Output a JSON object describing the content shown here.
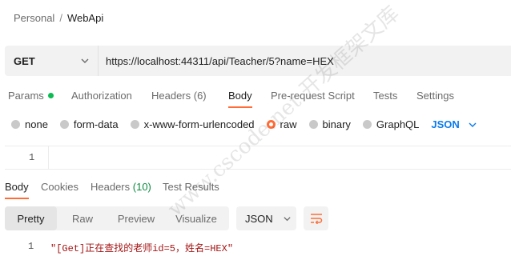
{
  "breadcrumb": {
    "workspace": "Personal",
    "separator": "/",
    "collection": "WebApi"
  },
  "request": {
    "method": "GET",
    "url": "https://localhost:44311/api/Teacher/5?name=HEX"
  },
  "request_tabs": [
    {
      "label": "Params",
      "has_dot": true
    },
    {
      "label": "Authorization"
    },
    {
      "label": "Headers (6)"
    },
    {
      "label": "Body",
      "active": true
    },
    {
      "label": "Pre-request Script"
    },
    {
      "label": "Tests"
    },
    {
      "label": "Settings"
    }
  ],
  "body_types": {
    "none": "none",
    "form_data": "form-data",
    "urlencoded": "x-www-form-urlencoded",
    "raw": "raw",
    "binary": "binary",
    "graphql": "GraphQL",
    "format": "JSON",
    "selected": "raw"
  },
  "editor": {
    "line_number": "1"
  },
  "response_tabs": {
    "body": "Body",
    "cookies": "Cookies",
    "headers": "Headers",
    "headers_count": "(10)",
    "test_results": "Test Results"
  },
  "view_modes": {
    "pretty": "Pretty",
    "raw": "Raw",
    "preview": "Preview",
    "visualize": "Visualize",
    "format": "JSON"
  },
  "response": {
    "line_number": "1",
    "text": "\"[Get]正在查找的老师id=5，姓名=HEX\""
  },
  "watermark": "www.cscode.net 开发框架文库",
  "colors": {
    "accent": "#ff6c37",
    "json_blue": "#097bed",
    "green_dot": "#0cbb52",
    "string_red": "#a31515"
  }
}
